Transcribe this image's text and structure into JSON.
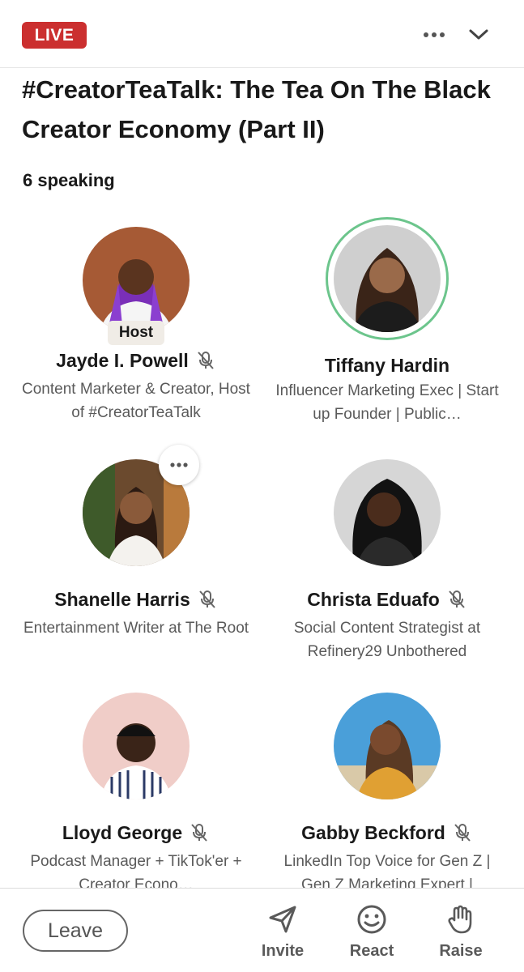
{
  "header": {
    "live_label": "LIVE",
    "more_icon": "more-horizontal-icon",
    "collapse_icon": "chevron-down-icon"
  },
  "event": {
    "title": "#CreatorTeaTalk: The Tea On The Black Creator Economy (Part II)",
    "speaking_count": "6 speaking"
  },
  "speakers": [
    {
      "name": "Jayde I. Powell",
      "headline": "Content Marketer & Creator, Host of #CreatorTeaTalk",
      "badge": "Host",
      "muted": true
    },
    {
      "name": "Tiffany Hardin",
      "headline": "Influencer Marketing Exec | Start up Founder | Public…",
      "muted": false,
      "speaking": true
    },
    {
      "name": "Shanelle Harris",
      "headline": "Entertainment Writer at The Root",
      "muted": true
    },
    {
      "name": "Christa Eduafo",
      "headline": "Social Content Strategist at Refinery29 Unbothered",
      "muted": true
    },
    {
      "name": "Lloyd George",
      "headline": "Podcast Manager + TikTok'er + Creator Econo…",
      "muted": true
    },
    {
      "name": "Gabby Beckford",
      "headline": "LinkedIn Top Voice for Gen Z | Gen Z Marketing Expert |",
      "muted": true
    }
  ],
  "footer": {
    "leave_label": "Leave",
    "invite_label": "Invite",
    "react_label": "React",
    "raise_label": "Raise"
  },
  "colors": {
    "live_red": "#cb2f2f",
    "speaking_ring": "#6cc58c",
    "secondary_text": "#5a5a5a"
  }
}
